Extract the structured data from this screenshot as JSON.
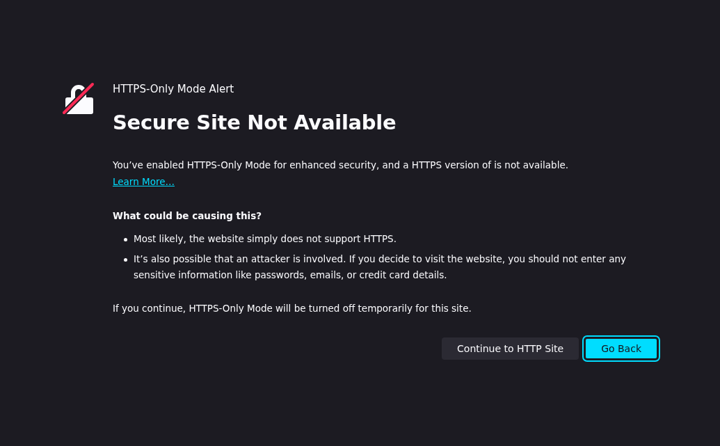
{
  "alert": {
    "label": "HTTPS-Only Mode Alert",
    "title": "Secure Site Not Available",
    "message": "You’ve enabled HTTPS-Only Mode for enhanced security, and a HTTPS version of is not available.",
    "link": "Learn More…"
  },
  "causes": {
    "heading": "What could be causing this?",
    "items": [
      "Most likely, the website simply does not support HTTPS.",
      "It’s also possible that an attacker is involved. If you decide to visit the website, you should not enter any sensitive information like passwords, emails, or credit card details."
    ]
  },
  "note": "If you continue, HTTPS-Only Mode will be turned off temporarily for this site.",
  "buttons": [
    {
      "label": "Continue to HTTP Site",
      "kind": "secondary",
      "focused": false
    },
    {
      "label": "Go Back",
      "kind": "primary",
      "focused": true
    }
  ]
}
